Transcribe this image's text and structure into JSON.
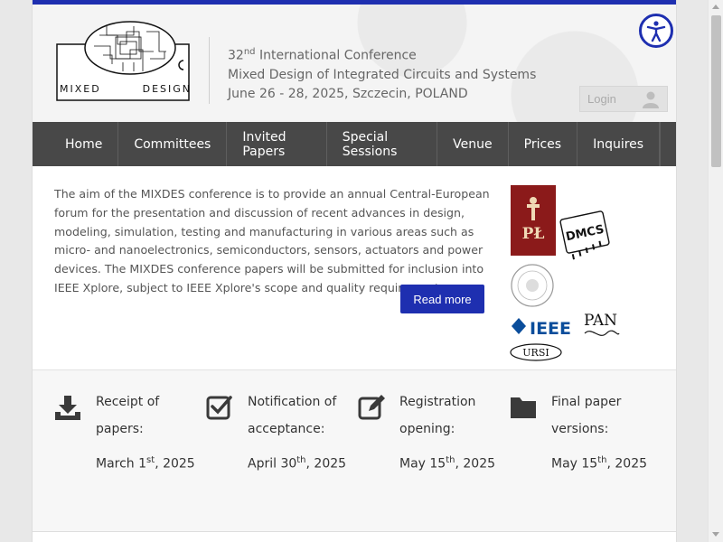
{
  "logo": {
    "word1": "MIXED",
    "word2": "DESIGN"
  },
  "conference": {
    "edition_num": "32",
    "edition_suffix": "nd",
    "edition_rest": " International Conference",
    "line2": "Mixed Design of Integrated Circuits and Systems",
    "line3": "June 26 - 28, 2025, Szczecin, POLAND"
  },
  "login": {
    "label": "Login"
  },
  "nav": {
    "items": [
      "Home",
      "Committees",
      "Invited Papers",
      "Special Sessions",
      "Venue",
      "Prices",
      "Inquires"
    ]
  },
  "intro": {
    "text": "The aim of the MIXDES conference is to provide an annual Central-European forum for the presentation and discussion of recent advances in design, modeling, simulation, testing and manufacturing in various areas such as micro- and nanoelectronics, semiconductors, sensors, actuators and power devices. The MIXDES conference papers will be submitted for inclusion into IEEE Xplore, subject to IEEE Xplore's scope and quality requirements.",
    "readmore": "Read more"
  },
  "partners": {
    "pl": "PŁ",
    "dmcs": "DMCS",
    "ieee": "IEEE",
    "pan": "PAN",
    "ursi": "URSI"
  },
  "dates": [
    {
      "label": "Receipt of papers:",
      "day": "March 1",
      "suffix": "st",
      "year": ", 2025",
      "icon": "download-icon"
    },
    {
      "label": "Notification of acceptance:",
      "day": "April 30",
      "suffix": "th",
      "year": ", 2025",
      "icon": "checkbox-icon"
    },
    {
      "label": "Registration opening:",
      "day": "May 15",
      "suffix": "th",
      "year": ", 2025",
      "icon": "edit-icon"
    },
    {
      "label": "Final paper versions:",
      "day": "May 15",
      "suffix": "th",
      "year": ", 2025",
      "icon": "folder-icon"
    }
  ],
  "colors": {
    "accent": "#1e2fb0",
    "nav_bg": "#484848"
  }
}
